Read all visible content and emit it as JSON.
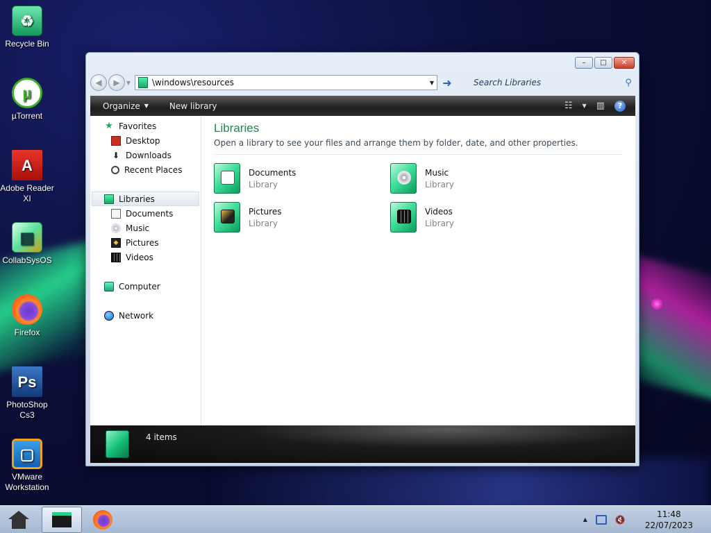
{
  "desktop": {
    "icons": [
      {
        "label": "Recycle Bin"
      },
      {
        "label": "µTorrent"
      },
      {
        "label": "Adobe Reader XI"
      },
      {
        "label": "CollabSysOS"
      },
      {
        "label": "Firefox"
      },
      {
        "label": "PhotoShop Cs3"
      },
      {
        "label": "VMware Workstation"
      }
    ]
  },
  "window": {
    "controls": {
      "minimize": "–",
      "maximize": "□",
      "close": "✕"
    },
    "address": {
      "path": "\\windows\\resources"
    },
    "search": {
      "placeholder": "Search Libraries"
    },
    "toolbar": {
      "organize": "Organize",
      "new_library": "New library"
    },
    "nav": {
      "favorites": "Favorites",
      "desktop": "Desktop",
      "downloads": "Downloads",
      "recent": "Recent Places",
      "libraries": "Libraries",
      "documents": "Documents",
      "music": "Music",
      "pictures": "Pictures",
      "videos": "Videos",
      "computer": "Computer",
      "network": "Network"
    },
    "content": {
      "title": "Libraries",
      "subtitle": "Open a library to see your files and arrange them by folder, date, and other properties.",
      "items": [
        {
          "name": "Documents",
          "type": "Library",
          "icon": "documents-library-icon"
        },
        {
          "name": "Music",
          "type": "Library",
          "icon": "music-library-icon"
        },
        {
          "name": "Pictures",
          "type": "Library",
          "icon": "pictures-library-icon"
        },
        {
          "name": "Videos",
          "type": "Library",
          "icon": "videos-library-icon"
        }
      ]
    },
    "status": {
      "count": "4 items"
    }
  },
  "taskbar": {
    "clock_time": "11:48",
    "clock_date": "22/07/2023"
  },
  "colors": {
    "accent_green": "#1d8a4c",
    "toolbar_dark": "#1e1e1e",
    "taskbar": "#b4c4dc"
  }
}
